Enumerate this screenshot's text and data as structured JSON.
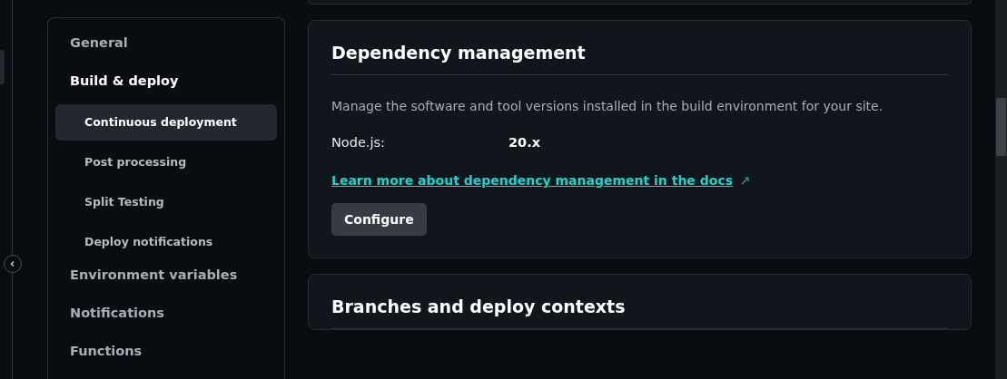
{
  "nav": [
    {
      "label": "General",
      "selected": false
    },
    {
      "label": "Build & deploy",
      "selected": true,
      "children": [
        {
          "label": "Continuous deployment",
          "selected": true
        },
        {
          "label": "Post processing",
          "selected": false
        },
        {
          "label": "Split Testing",
          "selected": false
        },
        {
          "label": "Deploy notifications",
          "selected": false
        }
      ]
    },
    {
      "label": "Environment variables",
      "selected": false
    },
    {
      "label": "Notifications",
      "selected": false
    },
    {
      "label": "Functions",
      "selected": false
    }
  ],
  "cards": [
    {
      "title": "Dependency management",
      "description": "Manage the software and tool versions installed in the build environment for your site.",
      "fields": [
        {
          "label": "Node.js:",
          "value": "20.x"
        }
      ],
      "link": "Learn more about dependency management in the docs",
      "button": "Configure"
    },
    {
      "title": "Branches and deploy contexts"
    }
  ]
}
